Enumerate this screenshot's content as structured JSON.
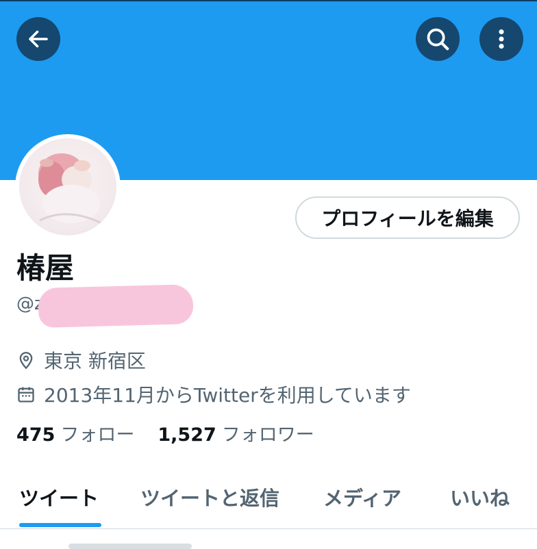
{
  "colors": {
    "banner": "#1d9bf0",
    "accent": "#1d9bf0",
    "text": "#0f1419",
    "muted": "#536471"
  },
  "header": {
    "back_icon": "arrow-left-icon",
    "search_icon": "search-icon",
    "more_icon": "more-vertical-icon"
  },
  "profile": {
    "name": "椿屋",
    "handle": "@zit",
    "edit_label": "プロフィールを編集",
    "location": "東京 新宿区",
    "joined": "2013年11月からTwitterを利用しています",
    "following_count": "475",
    "following_label": "フォロー",
    "followers_count": "1,527",
    "followers_label": "フォロワー"
  },
  "tabs": [
    {
      "label": "ツイート",
      "active": true
    },
    {
      "label": "ツイートと返信",
      "active": false
    },
    {
      "label": "メディア",
      "active": false
    },
    {
      "label": "いいね",
      "active": false
    }
  ]
}
